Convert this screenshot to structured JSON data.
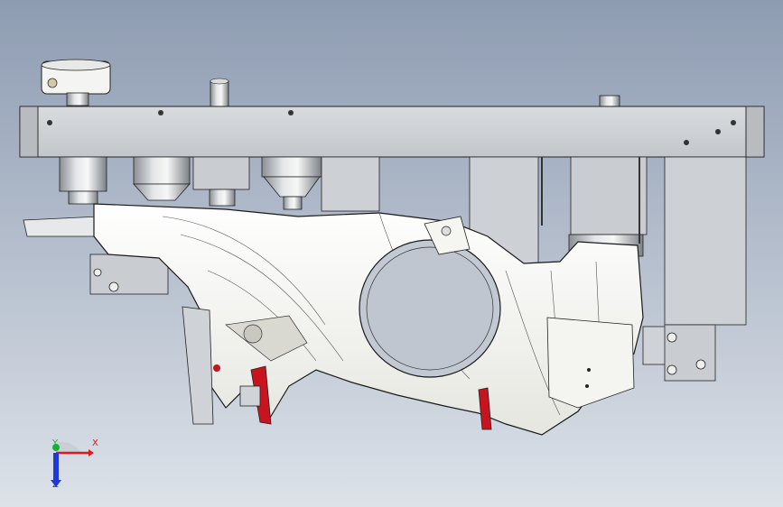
{
  "viewport": {
    "background_top": "#8e9cb2",
    "background_bottom": "#dde2e9",
    "part_color": "#f2f2ee",
    "fixture_color": "#cfd3d7",
    "edge_color": "#1a1a1a",
    "accent_red": "#c8141e"
  },
  "triad": {
    "x_label": "X",
    "y_label": "Y",
    "z_label": "Z",
    "x_color": "#e01818",
    "y_color": "#18b030",
    "z_color": "#2038d8"
  }
}
